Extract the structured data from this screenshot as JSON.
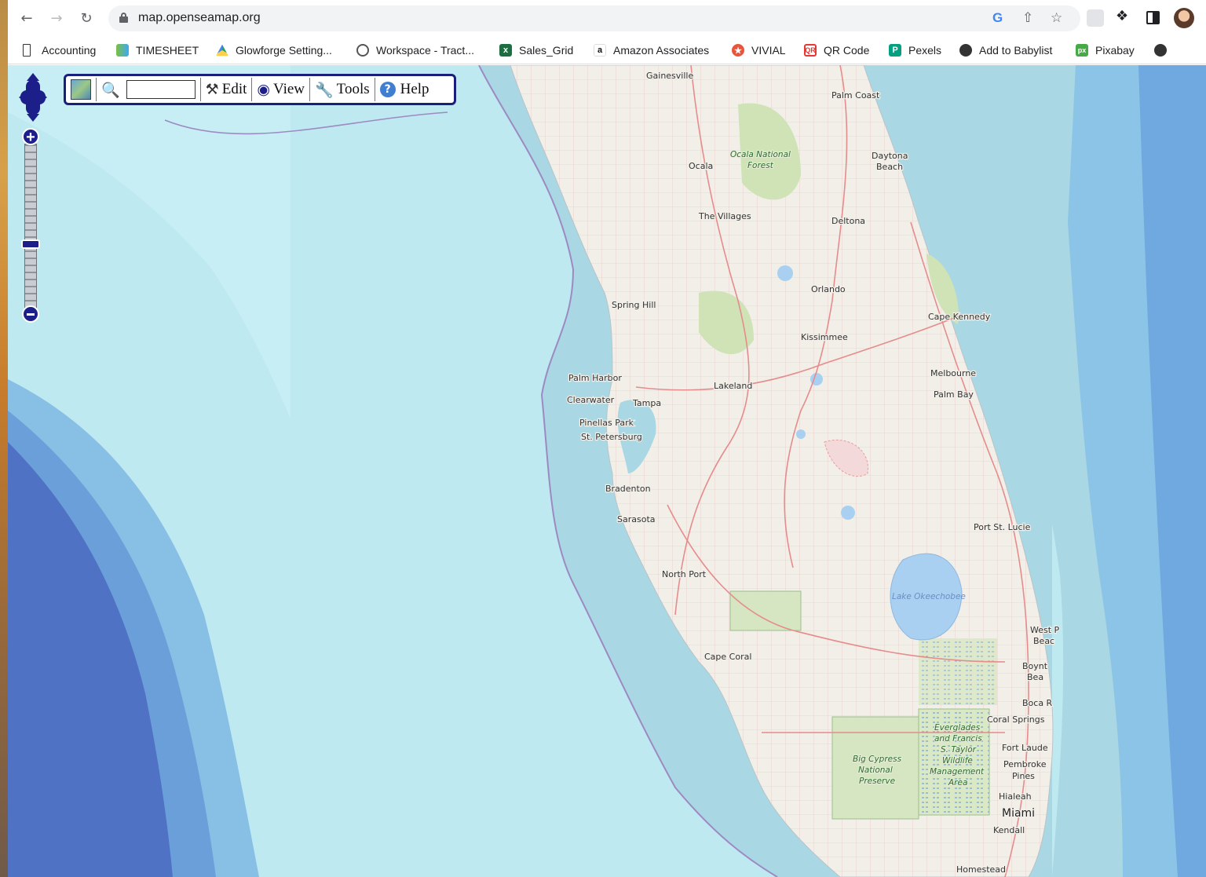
{
  "browser": {
    "url": "map.openseamap.org",
    "icons": [
      "back-arrow-icon",
      "forward-arrow-icon",
      "reload-icon",
      "lock-icon",
      "google-icon",
      "share-icon",
      "star-icon",
      "extension-icon",
      "puzzle-icon",
      "side-panel-icon",
      "profile-avatar"
    ]
  },
  "bookmarks": [
    {
      "label": "Accounting",
      "color": "#333333"
    },
    {
      "label": "TIMESHEET",
      "color": "#7bc043"
    },
    {
      "label": "Glowforge Setting...",
      "color": "#1fa463"
    },
    {
      "label": "Workspace - Tract...",
      "color": "#555555"
    },
    {
      "label": "Sales_Grid",
      "color": "#1d6f42"
    },
    {
      "label": "Amazon Associates",
      "color": "#111111"
    },
    {
      "label": "VIVIAL",
      "color": "#e8553d"
    },
    {
      "label": "QR Code",
      "color": "#e53935"
    },
    {
      "label": "Pexels",
      "color": "#05a081"
    },
    {
      "label": "Add to Babylist",
      "color": "#333333"
    },
    {
      "label": "Pixabay",
      "color": "#48a947"
    }
  ],
  "menu": {
    "edit": "Edit",
    "view": "View",
    "tools": "Tools",
    "help": "Help",
    "search_value": ""
  },
  "map": {
    "places": {
      "gainesville": "Gainesville",
      "palm_coast": "Palm Coast",
      "ocala": "Ocala",
      "daytona": "Daytona",
      "daytona2": "Beach",
      "the_villages": "The Villages",
      "deltona": "Deltona",
      "orlando": "Orlando",
      "spring_hill": "Spring Hill",
      "cape_kennedy": "Cape Kennedy",
      "kissimmee": "Kissimmee",
      "melbourne": "Melbourne",
      "palm_harbor": "Palm Harbor",
      "lakeland": "Lakeland",
      "palm_bay": "Palm Bay",
      "clearwater": "Clearwater",
      "tampa": "Tampa",
      "pinellas_park": "Pinellas Park",
      "st_petersburg": "St. Petersburg",
      "bradenton": "Bradenton",
      "sarasota": "Sarasota",
      "port_st_lucie": "Port St. Lucie",
      "north_port": "North Port",
      "west_palm": "West P",
      "west_palm2": "Beac",
      "cape_coral": "Cape Coral",
      "boynton": "Boynt",
      "boynton2": "Bea",
      "boca": "Boca R",
      "coral_springs": "Coral Springs",
      "fort_lauderdale": "Fort Laude",
      "pembroke": "Pembroke",
      "pembroke2": "Pines",
      "hialeah": "Hialeah",
      "miami": "Miami",
      "kendall": "Kendall",
      "homestead": "Homestead"
    },
    "parks": {
      "ocala_forest1": "Ocala National",
      "ocala_forest2": "Forest",
      "big_cypress1": "Big Cypress",
      "big_cypress2": "National",
      "big_cypress3": "Preserve",
      "everglades1": "Everglades",
      "everglades2": "and Francis",
      "everglades3": "S. Taylor",
      "everglades4": "Wildlife",
      "everglades5": "Management",
      "everglades6": "Area"
    },
    "water": {
      "okeechobee": "Lake Okeechobee"
    },
    "colors": {
      "deep_sea": "#4f72c5",
      "mid_sea": "#7fb2e3",
      "shelf": "#bfe9f1",
      "near_shore": "#a9d7e3",
      "land": "#f2efe9",
      "green_areas": "#cfe3b6",
      "roads": "#e58c8c"
    }
  }
}
